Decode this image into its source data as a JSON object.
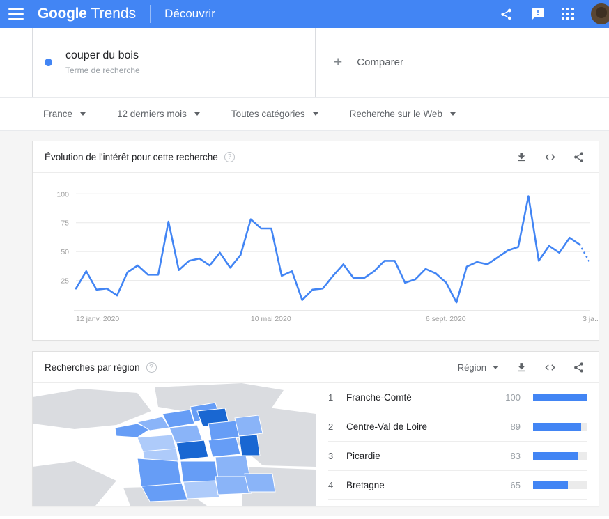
{
  "appbar": {
    "menu_icon": "hamburger-menu-icon",
    "brand_google": "Google",
    "brand_trends": "Trends",
    "discover": "Découvrir",
    "share_icon": "share-icon",
    "feedback_icon": "feedback-icon",
    "apps_icon": "apps-grid-icon",
    "avatar": "user-avatar",
    "bg_color": "#4285F4"
  },
  "term": {
    "dot_color": "#4285F4",
    "name": "couper du bois",
    "type": "Terme de recherche",
    "compare_plus": "+",
    "compare_label": "Comparer"
  },
  "filters": [
    {
      "label": "France"
    },
    {
      "label": "12 derniers mois"
    },
    {
      "label": "Toutes catégories"
    },
    {
      "label": "Recherche sur le Web"
    }
  ],
  "interest_card": {
    "title": "Évolution de l'intérêt pour cette recherche",
    "help": "?",
    "download_icon": "download-icon",
    "embed_icon": "embed-code-icon",
    "share_icon": "share-icon"
  },
  "region_card": {
    "title": "Recherches par région",
    "help": "?",
    "scope_label": "Région",
    "download_icon": "download-icon",
    "embed_icon": "embed-code-icon",
    "share_icon": "share-icon",
    "rows": [
      {
        "rank": "1",
        "name": "Franche-Comté",
        "value": "100",
        "pct": 100
      },
      {
        "rank": "2",
        "name": "Centre-Val de Loire",
        "value": "89",
        "pct": 89
      },
      {
        "rank": "3",
        "name": "Picardie",
        "value": "83",
        "pct": 83
      },
      {
        "rank": "4",
        "name": "Bretagne",
        "value": "65",
        "pct": 65
      }
    ],
    "map_colors": {
      "sea": "#ffffff",
      "outside": "#dadce0",
      "scale": [
        "#d2e3fc",
        "#aecbfa",
        "#8ab4f8",
        "#669df6",
        "#4285f4",
        "#1a73e8",
        "#1967d2"
      ]
    }
  },
  "chart_data": {
    "type": "line",
    "title": "Évolution de l'intérêt pour cette recherche",
    "xlabel": "",
    "ylabel": "",
    "ylim": [
      0,
      105
    ],
    "yticks": [
      25,
      50,
      75,
      100
    ],
    "grid": true,
    "legend": "couper du bois",
    "line_color": "#4285F4",
    "xtick_labels": [
      "12 janv. 2020",
      "10 mai 2020",
      "6 sept. 2020",
      "3 ja..."
    ],
    "xtick_positions": [
      0,
      17,
      34,
      51
    ],
    "partial_tail": true,
    "values": [
      18,
      33,
      17,
      18,
      12,
      32,
      38,
      30,
      30,
      76,
      34,
      42,
      44,
      38,
      49,
      36,
      47,
      78,
      70,
      70,
      29,
      33,
      8,
      17,
      18,
      29,
      39,
      27,
      27,
      33,
      42,
      42,
      23,
      26,
      35,
      31,
      23,
      6,
      37,
      41,
      39,
      45,
      51,
      54,
      98,
      42,
      55,
      49,
      62,
      56,
      40
    ]
  }
}
